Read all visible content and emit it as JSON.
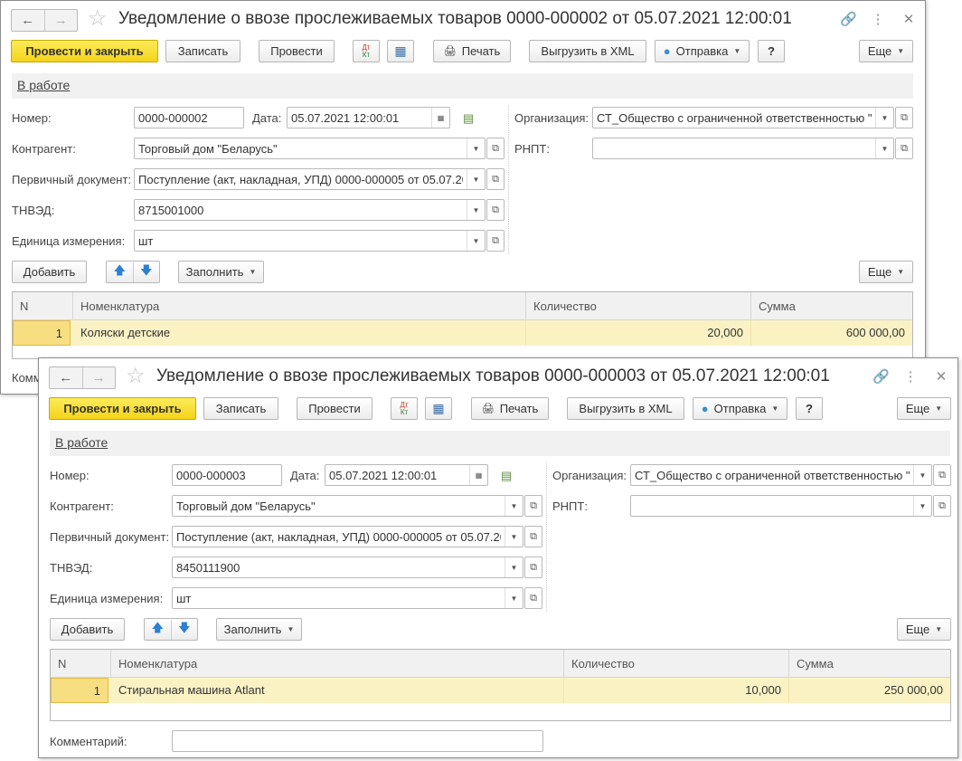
{
  "common": {
    "nav_back_icon": "arrow-left-icon",
    "nav_forward_icon": "arrow-right-icon",
    "star_icon": "star-icon",
    "link_icon": "link-icon",
    "menu_icon": "more-vert-icon",
    "close_icon": "close-icon",
    "toolbar": {
      "post_close": "Провести и закрыть",
      "save": "Записать",
      "post": "Провести",
      "dt_kt": "Дт\nКт",
      "print": "Печать",
      "export_xml": "Выгрузить в XML",
      "send": "Отправка",
      "help": "?",
      "more": "Еще"
    },
    "status": "В работе",
    "labels": {
      "number": "Номер:",
      "date": "Дата:",
      "organization": "Организация:",
      "counterparty": "Контрагент:",
      "rnpt": "РНПТ:",
      "primary_doc": "Первичный документ:",
      "tnved": "ТНВЭД:",
      "unit": "Единица измерения:",
      "comment": "Комментарий:"
    },
    "table_toolbar": {
      "add": "Добавить",
      "fill": "Заполнить",
      "more": "Еще"
    },
    "columns": [
      "N",
      "Номенклатура",
      "Количество",
      "Сумма"
    ]
  },
  "windows": [
    {
      "title": "Уведомление о ввозе прослеживаемых товаров 0000-000002 от 05.07.2021 12:00:01",
      "number": "0000-000002",
      "date": "05.07.2021 12:00:01",
      "organization": "СТ_Общество с ограниченной ответственностью \"К",
      "counterparty": "Торговый дом \"Беларусь\"",
      "rnpt": "",
      "primary_doc": "Поступление (акт, накладная, УПД) 0000-000005 от 05.07.2021",
      "tnved": "8715001000",
      "unit": "шт",
      "row": {
        "n": "1",
        "item": "Коляски детские",
        "qty": "20,000",
        "sum": "600 000,00"
      },
      "comment_label_visible": "Коммент"
    },
    {
      "title": "Уведомление о ввозе прослеживаемых товаров 0000-000003 от 05.07.2021 12:00:01",
      "number": "0000-000003",
      "date": "05.07.2021 12:00:01",
      "organization": "СТ_Общество с ограниченной ответственностью \"К",
      "counterparty": "Торговый дом \"Беларусь\"",
      "rnpt": "",
      "primary_doc": "Поступление (акт, накладная, УПД) 0000-000005 от 05.07.2021",
      "tnved": "8450111900",
      "unit": "шт",
      "row": {
        "n": "1",
        "item": "Стиральная машина Atlant",
        "qty": "10,000",
        "sum": "250 000,00"
      },
      "comment": ""
    }
  ]
}
